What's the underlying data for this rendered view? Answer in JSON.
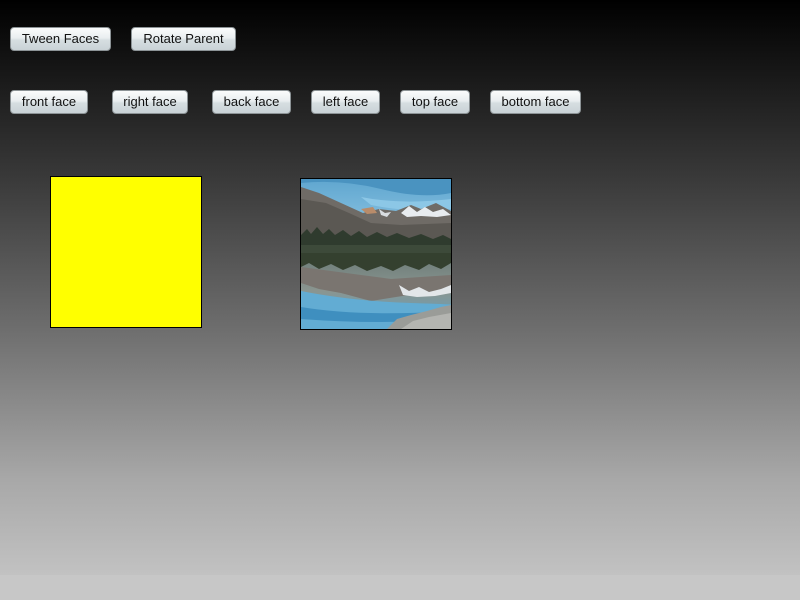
{
  "toolbar": {
    "tween_faces_label": "Tween Faces",
    "rotate_parent_label": "Rotate Parent"
  },
  "faces_nav": {
    "front_label": "front face",
    "right_label": "right face",
    "back_label": "back face",
    "left_label": "left face",
    "top_label": "top face",
    "bottom_label": "bottom face"
  },
  "stage": {
    "yellow_face_color": "#ffff00",
    "photo_description_icon": "mountain-lake-image"
  }
}
